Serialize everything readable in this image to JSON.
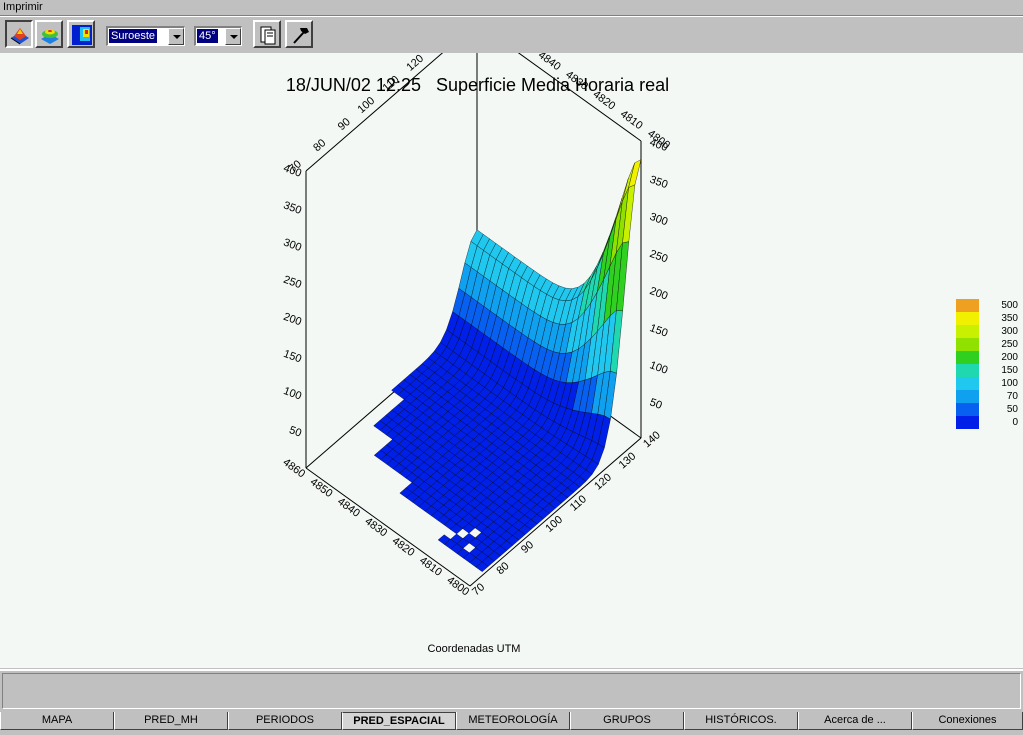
{
  "menu": {
    "print_label": "Imprimir"
  },
  "toolbar": {
    "buttons": [
      {
        "name": "surface-3d-button",
        "icon": "surface-3d-icon",
        "pressed": true
      },
      {
        "name": "contour-3d-button",
        "icon": "contour-3d-icon",
        "pressed": false
      },
      {
        "name": "map-2d-button",
        "icon": "colormap-icon",
        "pressed": false
      },
      {
        "name": "print-preview-button",
        "icon": "document-icon",
        "pressed": false
      },
      {
        "name": "tools-button",
        "icon": "hammer-icon",
        "pressed": false
      }
    ],
    "orientation_value": "Suroeste",
    "angle_value": "45°"
  },
  "chart_data": {
    "type": "surface3d",
    "title": "18/JUN/02 12:25   Superficie Media Horaria real",
    "xlabel": "Coordenadas UTM",
    "x_axis_ticks": [
      "70",
      "80",
      "90",
      "100",
      "110",
      "120",
      "130",
      "140"
    ],
    "y_axis_ticks": [
      "4800",
      "4810",
      "4820",
      "4830",
      "4840",
      "4850",
      "4860"
    ],
    "z_axis_ticks": [
      "50",
      "100",
      "150",
      "200",
      "250",
      "300",
      "350",
      "400"
    ],
    "x_range": [
      70,
      140
    ],
    "y_range": [
      4800,
      4860
    ],
    "z_range": [
      0,
      400
    ],
    "peak": {
      "x": 140,
      "y": 4800,
      "z": 400
    },
    "legend": [
      {
        "label": "500",
        "color": "#f0a020"
      },
      {
        "label": "350",
        "color": "#f0f000"
      },
      {
        "label": "300",
        "color": "#c8f000"
      },
      {
        "label": "250",
        "color": "#90e000"
      },
      {
        "label": "200",
        "color": "#30d020"
      },
      {
        "label": "150",
        "color": "#20d8b0"
      },
      {
        "label": "100",
        "color": "#20c8f0"
      },
      {
        "label": "70",
        "color": "#10a0f0"
      },
      {
        "label": "50",
        "color": "#0860f0"
      },
      {
        "label": "0",
        "color": "#0020e8"
      }
    ]
  },
  "tabs": [
    {
      "label": "MAPA",
      "active": false
    },
    {
      "label": "PRED_MH",
      "active": false
    },
    {
      "label": "PERIODOS",
      "active": false
    },
    {
      "label": "PRED_ESPACIAL",
      "active": true
    },
    {
      "label": "METEOROLOGÍA",
      "active": false
    },
    {
      "label": "GRUPOS",
      "active": false
    },
    {
      "label": "HISTÓRICOS.",
      "active": false
    },
    {
      "label": "Acerca de ...",
      "active": false
    },
    {
      "label": "Conexiones",
      "active": false
    }
  ]
}
